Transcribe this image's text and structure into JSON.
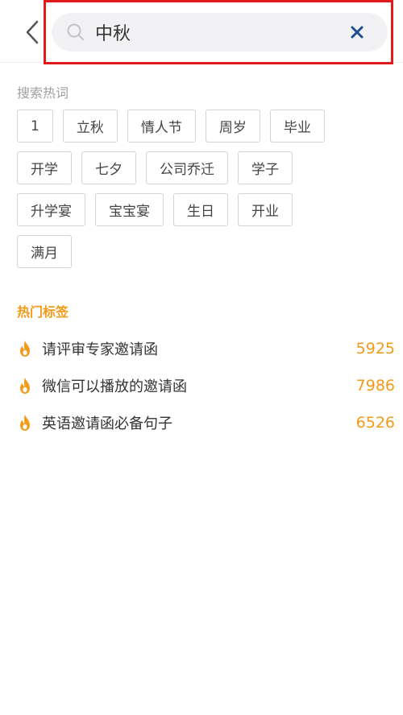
{
  "search": {
    "value": "中秋"
  },
  "hot_words": {
    "title": "搜索热词",
    "rows": [
      [
        "1",
        "立秋",
        "情人节",
        "周岁",
        "毕业"
      ],
      [
        "开学",
        "七夕",
        "公司乔迁",
        "学子"
      ],
      [
        "升学宴",
        "宝宝宴",
        "生日",
        "开业"
      ],
      [
        "满月"
      ]
    ]
  },
  "hot_tags": {
    "title": "热门标签",
    "items": [
      {
        "text": "请评审专家邀请函",
        "count": "5925"
      },
      {
        "text": "微信可以播放的邀请函",
        "count": "7986"
      },
      {
        "text": "英语邀请函必备句子",
        "count": "6526"
      }
    ]
  },
  "colors": {
    "accent": "#f39a19",
    "highlight_outline": "#e11b1b",
    "search_bg": "#f2f2f4",
    "clear_icon": "#1f4f8f"
  },
  "icons": {
    "back": "chevron-left-icon",
    "search": "search-icon",
    "clear": "close-icon",
    "hot": "fire-icon"
  }
}
